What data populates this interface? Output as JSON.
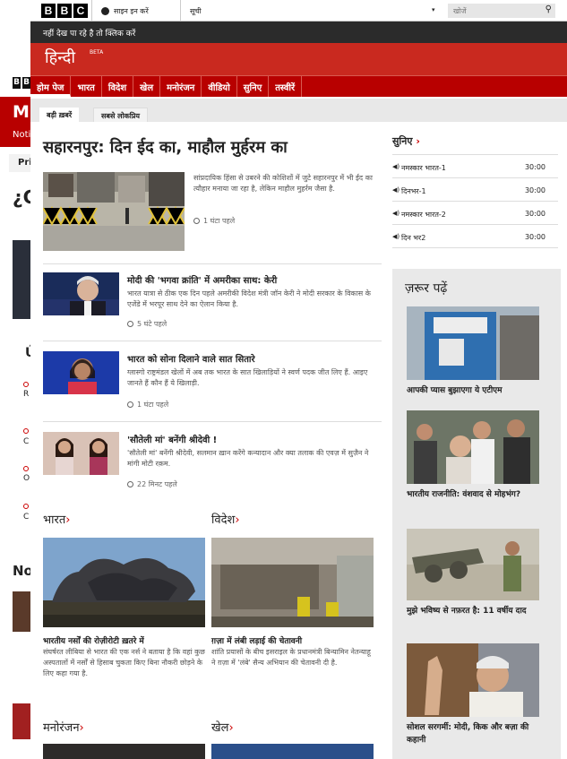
{
  "background_page": {
    "logo_letters": [
      "B",
      "B",
      "C"
    ],
    "red_title": "MU",
    "red_nav": "Notic",
    "tab": "Pri",
    "headline_fragment": "¿C en",
    "cards": [
      "Ú",
      "R E",
      "C",
      "O",
      "C"
    ],
    "section_fragment": "No"
  },
  "header": {
    "logo_letters": [
      "B",
      "B",
      "C"
    ],
    "signin_label": "साइन इन करें",
    "list_label": "सूची",
    "search_placeholder": "खोजें"
  },
  "notice": "नहीं देख पा रहे है तो क्लिक करें",
  "masthead": {
    "title": "हिन्दी",
    "beta": "BETA"
  },
  "nav": {
    "items": [
      "होम पेज",
      "भारत",
      "विदेश",
      "खेल",
      "मनोरंजन",
      "वीडियो",
      "सुनिए",
      "तस्वीरें"
    ]
  },
  "tabs": {
    "top": "बड़ी ख़बरें",
    "popular": "सबसे लोकप्रिय"
  },
  "lead": {
    "title": "सहारनपुर: दिन ईद का, माहौल मुर्हरम का",
    "summary": "सांप्रदायिक हिंसा से उबरने की कोशिशों में जुटे सहारनपुर में भी ईद का त्यौहार मनाया जा रहा है, लेकिन माहौल मुहर्रम जैसा है.",
    "time": "1 घंटा पहले"
  },
  "stories": [
    {
      "title": "मोदी की 'भगवा क्रांति' में अमरीका साथ: केरी",
      "summary": "भारत यात्रा से ठीक एक दिन पहले अमरीकी विदेश मंत्री जॉन केरी ने मोदी सरकार के विकास के एजेंडे में भरपूर साथ देने का ऐलान किया है.",
      "time": "5 घंटे पहले"
    },
    {
      "title": "भारत को सोना दिलाने वाले सात सितारे",
      "summary": "ग्लास्गो राष्ट्रमंडल खेलों में अब तक भारत के सात खिलाड़ियों ने स्वर्ण पदक जीत लिए हैं. आइए जानते हैं कौन हैं ये खिलाड़ी.",
      "time": "1 घंटा पहले"
    },
    {
      "title": "'सौतेली मां' बनेंगी श्रीदेवी !",
      "summary": "'सौतेली मां' बनेंगी श्रीदेवी, सलमान ख़ान करेंगे कन्यादान और क्या तलाक की एवज़ में सुज़ैन ने मांगी मोटी रक़म.",
      "time": "22 मिनट पहले"
    }
  ],
  "listen": {
    "heading": "सुनिए",
    "items": [
      {
        "name": "नमस्कार भारत-1",
        "time": "30:00"
      },
      {
        "name": "दिनभर-1",
        "time": "30:00"
      },
      {
        "name": "नमस्कार भारत-2",
        "time": "30:00"
      },
      {
        "name": "दिन भर2",
        "time": "30:00"
      }
    ]
  },
  "must_read": {
    "heading": "ज़रूर पढ़ें",
    "items": [
      "आपकी प्यास बुझाएगा ये एटीएम",
      "भारतीय राजनीति: वंशवाद से मोहभंग?",
      "मुझे भविष्य से नफ़रत है: 11 वर्षीय दाद",
      "सोशल सरगर्मी: मोदी, किक और बज़ा की कहानी"
    ]
  },
  "sections": [
    {
      "heading": "भारत",
      "title": "भारतीय नर्सों की रोज़ीरोटी ख़तरे में",
      "summary": "संघर्षरत लीबिया से भारत की एक नर्स ने बताया है कि वहां कुछ अस्पतालों में नर्सों से हिसाब चुकता किए बिना नौकरी छोड़ने के लिए कहा गया है."
    },
    {
      "heading": "विदेश",
      "title": "ग़ज़ा में लंबी लड़ाई की चेतावनी",
      "summary": "शांति प्रयासों के बीच इसराइल के प्रधानमंत्री बिन्यामिन नेतन्याहू ने ग़ज़ा में 'लंबे' सैन्य अभियान की चेतावनी दी है."
    },
    {
      "heading": "मनोरंजन"
    },
    {
      "heading": "खेल"
    }
  ],
  "colors": {
    "brand_red": "#b80000",
    "masthead_red": "#c9291f",
    "dark_bar": "#2b2b2b",
    "accent_chevron": "#cc0000"
  }
}
